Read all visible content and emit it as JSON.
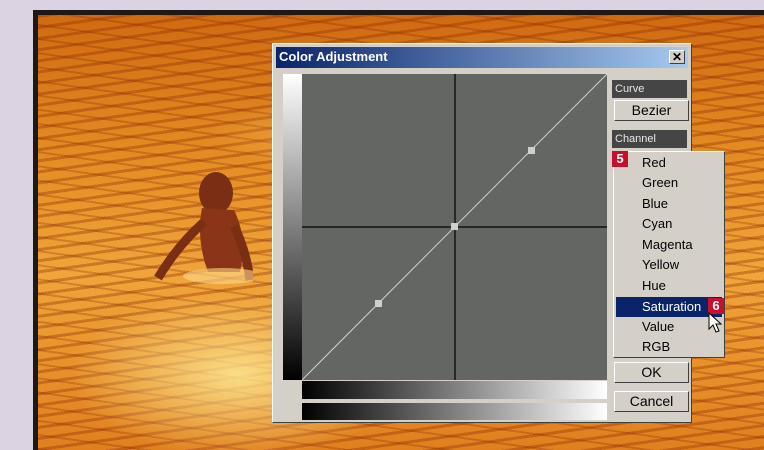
{
  "dialog": {
    "title": "Color Adjustment",
    "close_label": "✕"
  },
  "curve": {
    "header": "Curve",
    "button_label": "Bezier"
  },
  "channel": {
    "header": "Channel",
    "items": [
      "Red",
      "Green",
      "Blue",
      "Cyan",
      "Magenta",
      "Yellow",
      "Hue",
      "Saturation",
      "Value",
      "RGB"
    ],
    "selected": "Saturation"
  },
  "actions": {
    "ok_label": "OK",
    "cancel_label": "Cancel"
  },
  "annotations": {
    "badge_5": "5",
    "badge_6": "6"
  },
  "colors": {
    "title_gradient_start": "#0a246a",
    "title_gradient_end": "#a6caf0",
    "selection": "#0a246a",
    "badge": "#c8102e",
    "curve_panel": "#646664"
  },
  "icons": {
    "close": "close-icon",
    "cursor": "arrow-cursor-icon"
  }
}
